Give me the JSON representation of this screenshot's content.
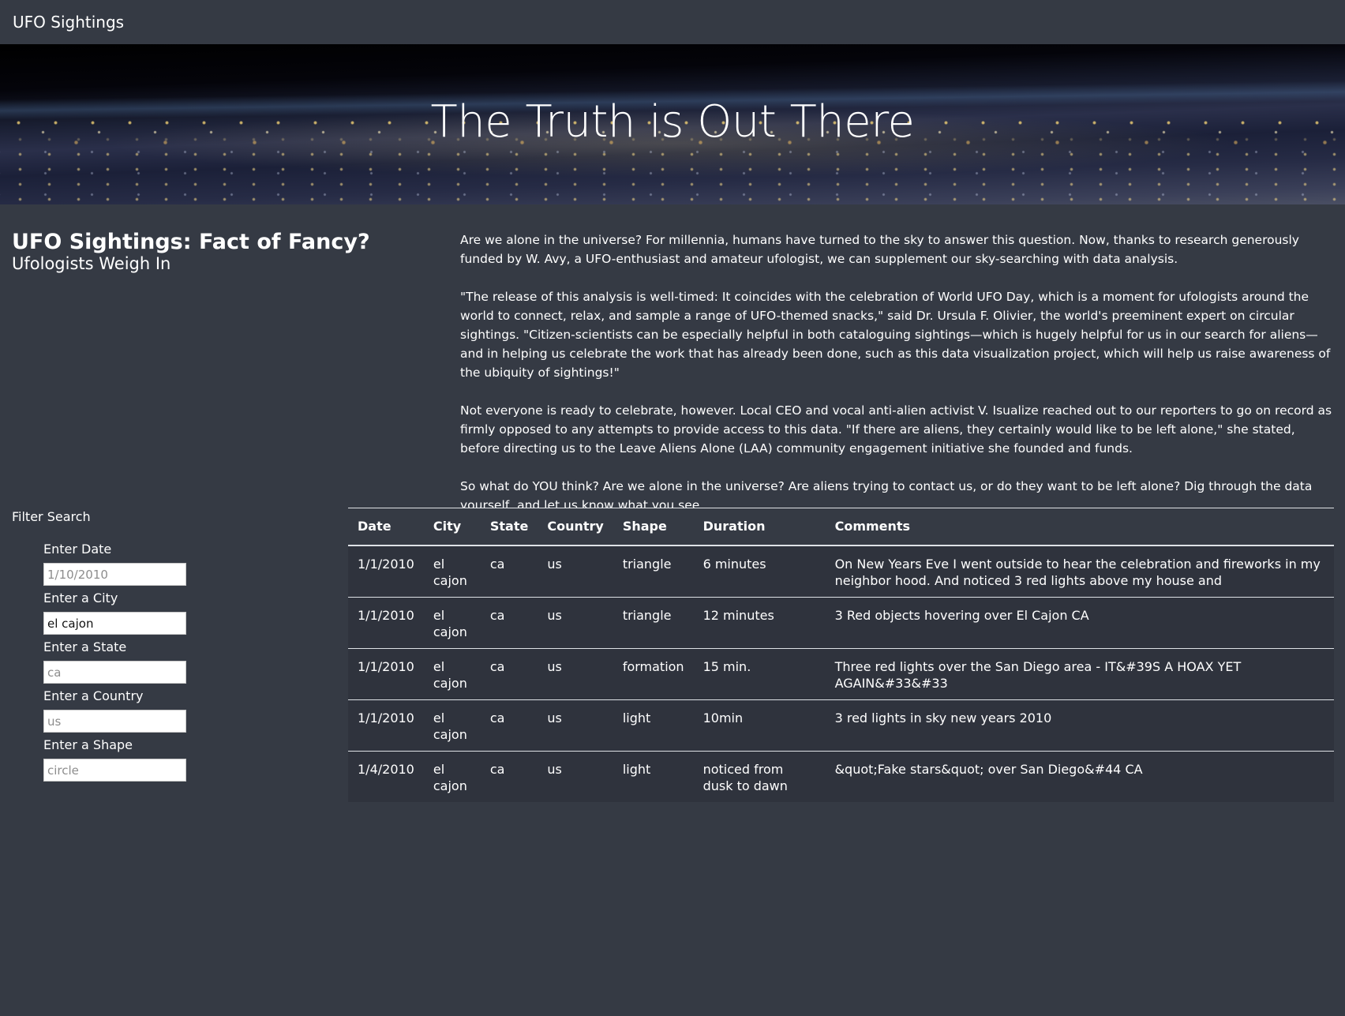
{
  "navbar": {
    "brand": "UFO Sightings"
  },
  "hero": {
    "title": "The Truth is Out There"
  },
  "intro": {
    "heading_main": "UFO Sightings: Fact of Fancy?",
    "heading_sub": "Ufologists Weigh In"
  },
  "article": {
    "paragraphs": [
      "Are we alone in the universe? For millennia, humans have turned to the sky to answer this question. Now, thanks to research generously funded by W. Avy, a UFO-enthusiast and amateur ufologist, we can supplement our sky-searching with data analysis.",
      "\"The release of this analysis is well-timed: It coincides with the celebration of World UFO Day, which is a moment for ufologists around the world to connect, relax, and sample a range of UFO-themed snacks,\" said Dr. Ursula F. Olivier, the world's preeminent expert on circular sightings. \"Citizen-scientists can be especially helpful in both cataloguing sightings—which is hugely helpful for us in our search for aliens—and in helping us celebrate the work that has already been done, such as this data visualization project, which will help us raise awareness of the ubiquity of sightings!\"",
      "Not everyone is ready to celebrate, however. Local CEO and vocal anti-alien activist V. Isualize reached out to our reporters to go on record as firmly opposed to any attempts to provide access to this data. \"If there are aliens, they certainly would like to be left alone,\" she stated, before directing us to the Leave Aliens Alone (LAA) community engagement initiative she founded and funds.",
      "So what do YOU think? Are we alone in the universe? Are aliens trying to contact us, or do they want to be left alone? Dig through the data yourself, and let us know what you see."
    ]
  },
  "filters": {
    "title": "Filter Search",
    "fields": [
      {
        "label": "Enter Date",
        "value": "",
        "placeholder": "1/10/2010"
      },
      {
        "label": "Enter a City",
        "value": "el cajon",
        "placeholder": ""
      },
      {
        "label": "Enter a State",
        "value": "",
        "placeholder": "ca"
      },
      {
        "label": "Enter a Country",
        "value": "",
        "placeholder": "us"
      },
      {
        "label": "Enter a Shape",
        "value": "",
        "placeholder": "circle"
      }
    ]
  },
  "table": {
    "headers": [
      "Date",
      "City",
      "State",
      "Country",
      "Shape",
      "Duration",
      "Comments"
    ],
    "rows": [
      [
        "1/1/2010",
        "el cajon",
        "ca",
        "us",
        "triangle",
        "6 minutes",
        "On New Years Eve I went outside to hear the celebration and fireworks in my neighbor hood. And noticed 3 red lights above my house and"
      ],
      [
        "1/1/2010",
        "el cajon",
        "ca",
        "us",
        "triangle",
        "12 minutes",
        "3 Red objects hovering over El Cajon CA"
      ],
      [
        "1/1/2010",
        "el cajon",
        "ca",
        "us",
        "formation",
        "15 min.",
        "Three red lights over the San Diego area - IT&#39S A HOAX YET AGAIN&#33&#33"
      ],
      [
        "1/1/2010",
        "el cajon",
        "ca",
        "us",
        "light",
        "10min",
        "3 red lights in sky new years 2010"
      ],
      [
        "1/4/2010",
        "el cajon",
        "ca",
        "us",
        "light",
        "noticed from dusk to dawn",
        "&quot;Fake stars&quot; over San Diego&#44 CA"
      ]
    ]
  }
}
